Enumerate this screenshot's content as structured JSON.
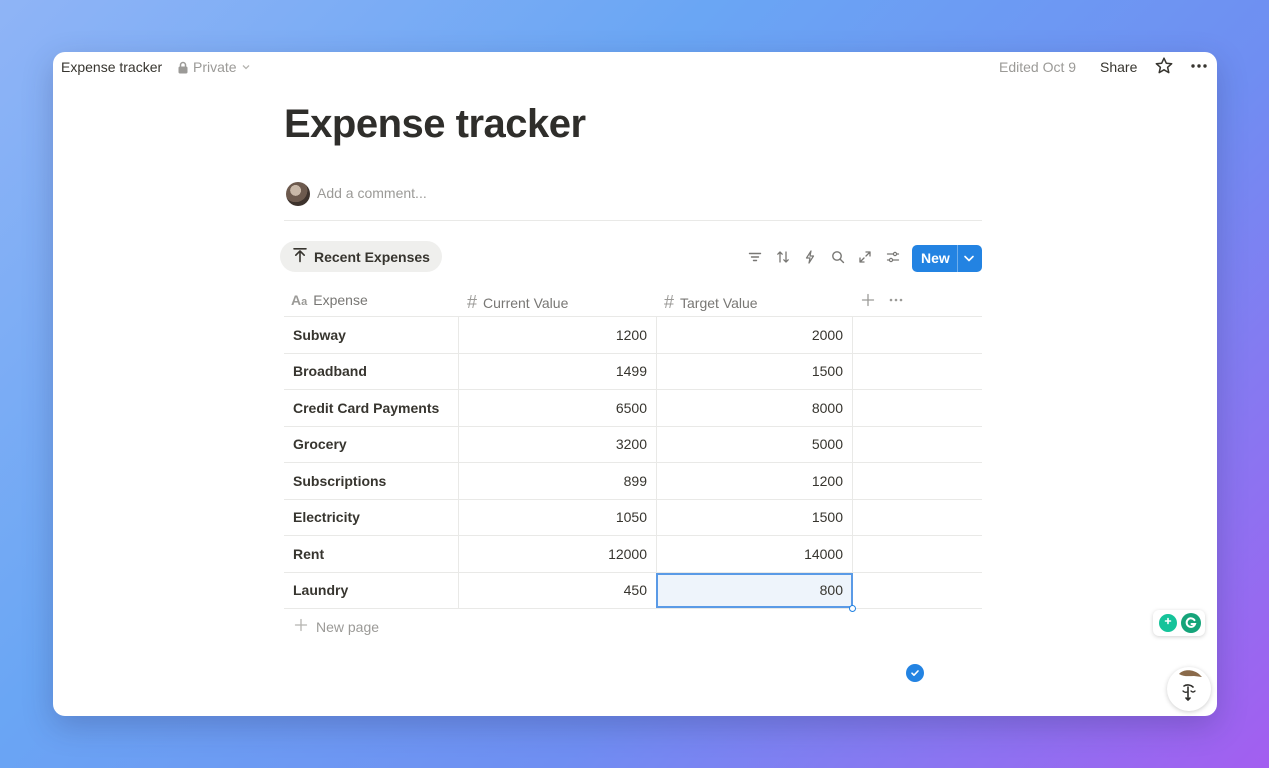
{
  "topbar": {
    "breadcrumb_title": "Expense tracker",
    "privacy": "Private",
    "edited": "Edited Oct 9",
    "share_label": "Share"
  },
  "page": {
    "title": "Expense tracker",
    "comment_placeholder": "Add a comment..."
  },
  "database": {
    "view_name": "Recent Expenses",
    "new_label": "New",
    "columns": [
      "Expense",
      "Current Value",
      "Target Value"
    ],
    "rows": [
      {
        "expense": "Subway",
        "current": "1200",
        "target": "2000"
      },
      {
        "expense": "Broadband",
        "current": "1499",
        "target": "1500"
      },
      {
        "expense": "Credit Card Payments",
        "current": "6500",
        "target": "8000"
      },
      {
        "expense": "Grocery",
        "current": "3200",
        "target": "5000"
      },
      {
        "expense": "Subscriptions",
        "current": "899",
        "target": "1200"
      },
      {
        "expense": "Electricity",
        "current": "1050",
        "target": "1500"
      },
      {
        "expense": "Rent",
        "current": "12000",
        "target": "14000"
      },
      {
        "expense": "Laundry",
        "current": "450",
        "target": "800"
      }
    ],
    "new_page_label": "New page"
  },
  "icons": {
    "lock": "lock-icon",
    "star": "star-icon",
    "more": "more-icon",
    "filter": "filter-icon",
    "sort": "sort-icon",
    "automation": "lightning-icon",
    "search": "search-icon",
    "expand": "expand-icon",
    "settings": "settings-icon"
  },
  "colors": {
    "accent": "#2383e2",
    "selected_cell_bg": "#eef4fb"
  }
}
